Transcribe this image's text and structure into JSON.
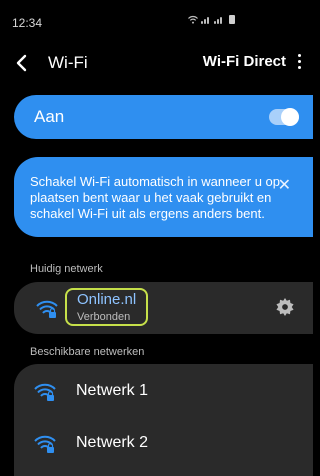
{
  "status_bar": {
    "time": "12:34"
  },
  "header": {
    "title": "Wi-Fi",
    "action_label": "Wi-Fi Direct"
  },
  "wifi_toggle": {
    "label": "Aan",
    "state": "on",
    "accent_color": "#2f8ff0"
  },
  "tip": {
    "text": "Schakel Wi-Fi automatisch in wanneer u op plaatsen bent waar u het vaak gebruikt en schakel Wi-Fi uit als ergens anders bent.",
    "close_icon": "close-icon"
  },
  "current_network": {
    "section_label": "Huidig netwerk",
    "name": "Online.nl",
    "status": "Verbonden",
    "highlight_color": "#c6e04a"
  },
  "available_networks": {
    "section_label": "Beschikbare netwerken",
    "items": [
      {
        "name": "Netwerk 1"
      },
      {
        "name": "Netwerk 2"
      }
    ]
  }
}
